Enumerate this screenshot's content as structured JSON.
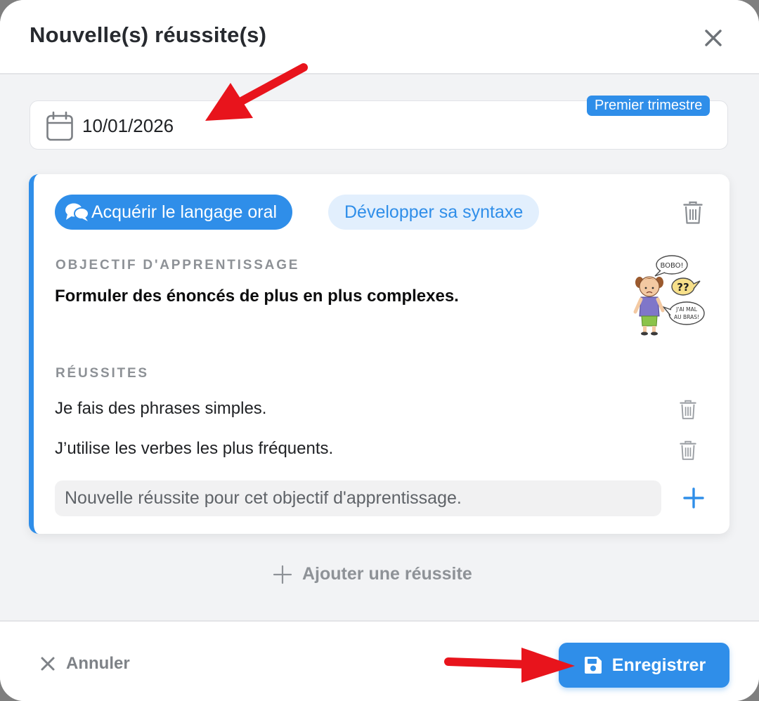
{
  "dialog": {
    "title": "Nouvelle(s) réussite(s)"
  },
  "date_field": {
    "value": "10/01/2026",
    "term_badge": "Premier trimestre"
  },
  "card": {
    "chips": {
      "domain": "Acquérir le langage oral",
      "subdomain": "Développer sa syntaxe"
    },
    "objective_label": "OBJECTIF D'APPRENTISSAGE",
    "objective_text": "Formuler des énoncés de plus en plus complexes.",
    "illustration": {
      "bubble_1": "BOBO!",
      "bubble_2": "??",
      "bubble_3_line_1": "J'AI MAL",
      "bubble_3_line_2": "AU BRAS!"
    },
    "successes_label": "RÉUSSITES",
    "successes": [
      "Je fais des phrases simples.",
      "J’utilise les verbes les plus fréquents."
    ],
    "new_success_placeholder": "Nouvelle réussite pour cet objectif d'apprentissage."
  },
  "add_success_label": "Ajouter une réussite",
  "footer": {
    "cancel_label": "Annuler",
    "save_label": "Enregistrer"
  },
  "colors": {
    "accent": "#2f8ee9",
    "chip_secondary_bg": "#e2effd",
    "annotation_arrow": "#e8141c"
  },
  "icons": {
    "close": "close-icon",
    "calendar": "calendar-icon",
    "chat": "chat-bubbles-icon",
    "trash": "trash-icon",
    "plus": "plus-icon",
    "save": "floppy-disk-icon",
    "cancel": "x-icon"
  }
}
